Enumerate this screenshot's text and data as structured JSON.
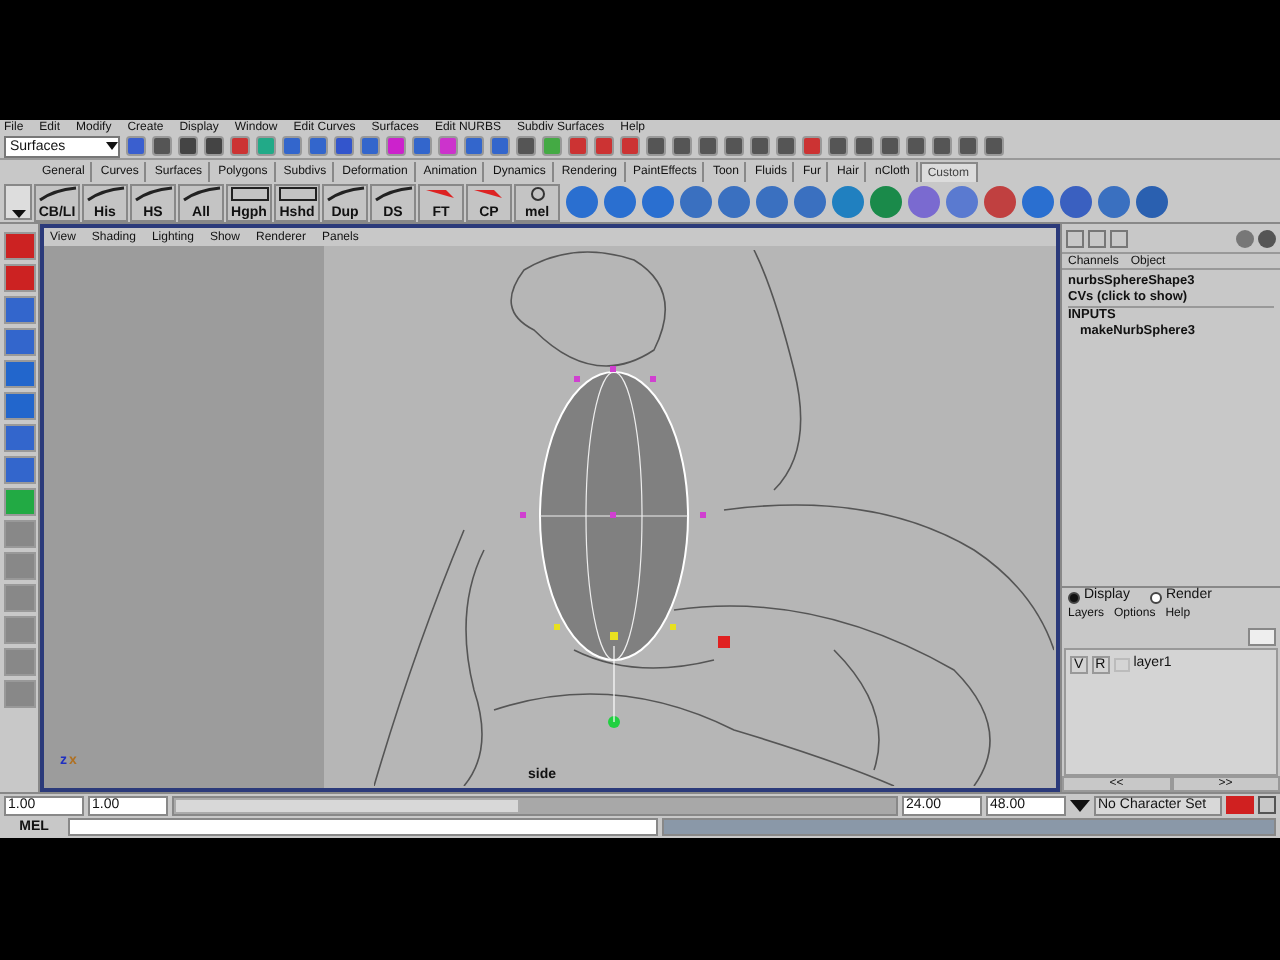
{
  "menu_bar": [
    "File",
    "Edit",
    "Modify",
    "Create",
    "Display",
    "Window",
    "Edit Curves",
    "Surfaces",
    "Edit NURBS",
    "Subdiv Surfaces",
    "Help"
  ],
  "status_line": {
    "menu_set": "Surfaces"
  },
  "shelf_tabs": [
    {
      "label": "General",
      "selected": false
    },
    {
      "label": "Curves",
      "selected": false
    },
    {
      "label": "Surfaces",
      "selected": false
    },
    {
      "label": "Polygons",
      "selected": false
    },
    {
      "label": "Subdivs",
      "selected": false
    },
    {
      "label": "Deformation",
      "selected": false
    },
    {
      "label": "Animation",
      "selected": false
    },
    {
      "label": "Dynamics",
      "selected": false
    },
    {
      "label": "Rendering",
      "selected": false
    },
    {
      "label": "PaintEffects",
      "selected": false
    },
    {
      "label": "Toon",
      "selected": false
    },
    {
      "label": "Fluids",
      "selected": false
    },
    {
      "label": "Fur",
      "selected": false
    },
    {
      "label": "Hair",
      "selected": false
    },
    {
      "label": "nCloth",
      "selected": false
    },
    {
      "label": "Custom",
      "selected": true
    }
  ],
  "shelf_buttons": [
    {
      "label": "CB/LI",
      "kind": "curve"
    },
    {
      "label": "His",
      "kind": "curve"
    },
    {
      "label": "HS",
      "kind": "curve"
    },
    {
      "label": "All",
      "kind": "curve"
    },
    {
      "label": "Hgph",
      "kind": "graph"
    },
    {
      "label": "Hshd",
      "kind": "graph"
    },
    {
      "label": "Dup",
      "kind": "curve"
    },
    {
      "label": "DS",
      "kind": "curve"
    },
    {
      "label": "FT",
      "kind": "arrow"
    },
    {
      "label": "CP",
      "kind": "arrow"
    },
    {
      "label": "mel",
      "kind": "script"
    }
  ],
  "viewport": {
    "menu": [
      "View",
      "Shading",
      "Lighting",
      "Show",
      "Renderer",
      "Panels"
    ],
    "camera_label": "side",
    "axis_labels": [
      "z",
      "x"
    ]
  },
  "channel_box": {
    "tabs": [
      "Channels",
      "Object"
    ],
    "node": "nurbsSphereShape3",
    "cvs": "CVs (click to show)",
    "inputs_header": "INPUTS",
    "inputs": [
      "makeNurbSphere3"
    ]
  },
  "layer_editor": {
    "modes": [
      {
        "label": "Display",
        "selected": true
      },
      {
        "label": "Render",
        "selected": false
      }
    ],
    "menu": [
      "Layers",
      "Options",
      "Help"
    ],
    "layers": [
      {
        "name": "layer1",
        "visible": "V",
        "render": "R"
      }
    ],
    "scroll": [
      "<<",
      ">>"
    ]
  },
  "range_slider": {
    "start": "1.00",
    "range_start": "1.00",
    "range_end": "24.00",
    "end": "48.00",
    "level": 0.48
  },
  "character_set": "No Character Set",
  "command_line": {
    "label": "MEL"
  }
}
